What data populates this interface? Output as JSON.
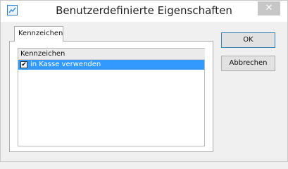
{
  "window": {
    "title": "Benutzerdefinierte Eigenschaften",
    "close_label": "✕",
    "app_icon": "chart-icon"
  },
  "tabs": [
    {
      "label": "Kennzeichen",
      "selected": true
    }
  ],
  "list": {
    "header": "Kennzeichen",
    "items": [
      {
        "label": "in Kasse verwenden",
        "checked": true,
        "check_glyph": "✔",
        "selected": true
      }
    ]
  },
  "buttons": {
    "ok_label": "OK",
    "cancel_label": "Abbrechen"
  },
  "colors": {
    "selection": "#3399ff",
    "accent": "#2f7fcf"
  }
}
